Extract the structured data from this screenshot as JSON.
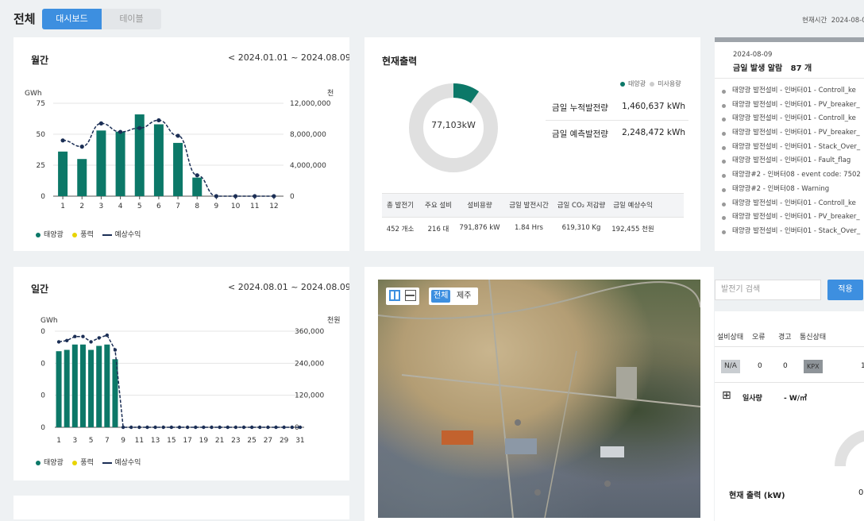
{
  "header": {
    "title": "전체",
    "tabs": [
      {
        "label": "대시보드"
      },
      {
        "label": "테이블"
      }
    ],
    "time_label": "현재시간",
    "time_value": "2024-08-0"
  },
  "colors": {
    "accent": "#3d8fe0",
    "solar": "#0c7868",
    "wind": "#e8d400",
    "revenue": "#1b2e55"
  },
  "monthly": {
    "title": "월간",
    "range": "2024.01.01 ~ 2024.08.09",
    "ylabel_left": "GWh",
    "ylabel_right": "천",
    "legend": [
      "태양광",
      "풍력",
      "예상수익"
    ],
    "chart_data": {
      "type": "bar",
      "categories": [
        "1",
        "2",
        "3",
        "4",
        "5",
        "6",
        "7",
        "8",
        "9",
        "10",
        "11",
        "12"
      ],
      "ylim": [
        0,
        75
      ],
      "y2lim": [
        0,
        12000000
      ],
      "yticks": [
        "75",
        "50",
        "25",
        "0"
      ],
      "y2ticks": [
        "12,000,000",
        "8,000,000",
        "4,000,000",
        "0"
      ],
      "series": [
        {
          "name": "태양광",
          "type": "bar",
          "values": [
            36,
            30,
            53,
            52,
            66,
            58,
            43,
            15,
            0,
            0,
            0,
            0
          ]
        },
        {
          "name": "예상수익",
          "type": "line",
          "axis": "right",
          "values": [
            7200000,
            6400000,
            9400000,
            8300000,
            8800000,
            9800000,
            7800000,
            2700000,
            0,
            0,
            0,
            0
          ]
        }
      ]
    }
  },
  "daily": {
    "title": "일간",
    "range": "2024.08.01 ~ 2024.08.09",
    "ylabel_left": "GWh",
    "ylabel_right": "천원",
    "legend": [
      "태양광",
      "풍력",
      "예상수익"
    ],
    "chart_data": {
      "type": "bar",
      "categories": [
        "1",
        "2",
        "3",
        "4",
        "5",
        "6",
        "7",
        "8",
        "9",
        "10",
        "11",
        "12",
        "13",
        "14",
        "15",
        "16",
        "17",
        "18",
        "19",
        "20",
        "21",
        "22",
        "23",
        "24",
        "25",
        "26",
        "27",
        "28",
        "29",
        "30",
        "31"
      ],
      "xtick_labels": [
        "1",
        "3",
        "5",
        "7",
        "9",
        "11",
        "13",
        "15",
        "17",
        "19",
        "21",
        "23",
        "25",
        "27",
        "29",
        "31"
      ],
      "y2lim": [
        0,
        360000
      ],
      "yticks": [
        "0",
        "0",
        "0",
        "0"
      ],
      "y2ticks": [
        "360,000",
        "240,000",
        "120,000",
        "0"
      ],
      "series": [
        {
          "name": "태양광",
          "type": "bar",
          "axis": "right",
          "values": [
            285000,
            290000,
            310000,
            310000,
            290000,
            305000,
            310000,
            255000,
            0,
            0,
            0,
            0,
            0,
            0,
            0,
            0,
            0,
            0,
            0,
            0,
            0,
            0,
            0,
            0,
            0,
            0,
            0,
            0,
            0,
            0,
            0
          ]
        },
        {
          "name": "예상수익",
          "type": "line",
          "axis": "right",
          "values": [
            320000,
            325000,
            340000,
            340000,
            320000,
            335000,
            345000,
            290000,
            0,
            0,
            0,
            0,
            0,
            0,
            0,
            0,
            0,
            0,
            0,
            0,
            0,
            0,
            0,
            0,
            0,
            0,
            0,
            0,
            0,
            0,
            0
          ]
        }
      ]
    }
  },
  "output": {
    "title": "현재출력",
    "center": "77,103kW",
    "legend": [
      "태양광",
      "미사용량"
    ],
    "chart_data": {
      "type": "pie",
      "labels": [
        "태양광",
        "미사용량"
      ],
      "values": [
        9.7,
        90.3
      ]
    },
    "kpis": [
      {
        "label": "금일 누적발전량",
        "value": "1,460,637 kWh"
      },
      {
        "label": "금일 예측발전량",
        "value": "2,248,472 kWh"
      }
    ],
    "table_headers": [
      "총 발전기",
      "주요 설비",
      "설비용량",
      "금일 발전시간",
      "금일 CO₂ 저감량",
      "금일 예상수익"
    ],
    "table_values": [
      "452 개소",
      "216 대",
      "791,876 kW",
      "1.84 Hrs",
      "619,310 Kg",
      "192,455 천원"
    ]
  },
  "alarms": {
    "date": "2024-08-09",
    "title": "금일 발생 알람",
    "count": "87 개",
    "items": [
      "태양광 발전설비 - 인버터01 - Controll_ke",
      "태양광 발전설비 - 인버터01 - PV_breaker_",
      "태양광 발전설비 - 인버터01 - Controll_ke",
      "태양광 발전설비 - 인버터01 - PV_breaker_",
      "태양광 발전설비 - 인버터01 - Stack_Over_",
      "태양광 발전설비 - 인버터01 - Fault_flag",
      "태양광#2 - 인버터08 - event code: 7502",
      "태양광#2 - 인버터08 - Warning",
      "태양광 발전설비 - 인버터01 - Controll_ke",
      "태양광 발전설비 - 인버터01 - PV_breaker_",
      "태양광 발전설비 - 인버터01 - Stack_Over_"
    ]
  },
  "map": {
    "filters": [
      "전체",
      "제주"
    ]
  },
  "search": {
    "placeholder": "발전기 검색",
    "apply": "적용",
    "headers": [
      "설비상태",
      "오류",
      "경고",
      "통신상태"
    ],
    "row": {
      "status": "N/A",
      "error": "0",
      "warning": "0",
      "comm": "KPX",
      "extra": "1"
    },
    "irradiance_label": "일사량",
    "irradiance_value": "- W/㎡",
    "output_label": "현재 출력 (kW)",
    "output_value": "0"
  }
}
